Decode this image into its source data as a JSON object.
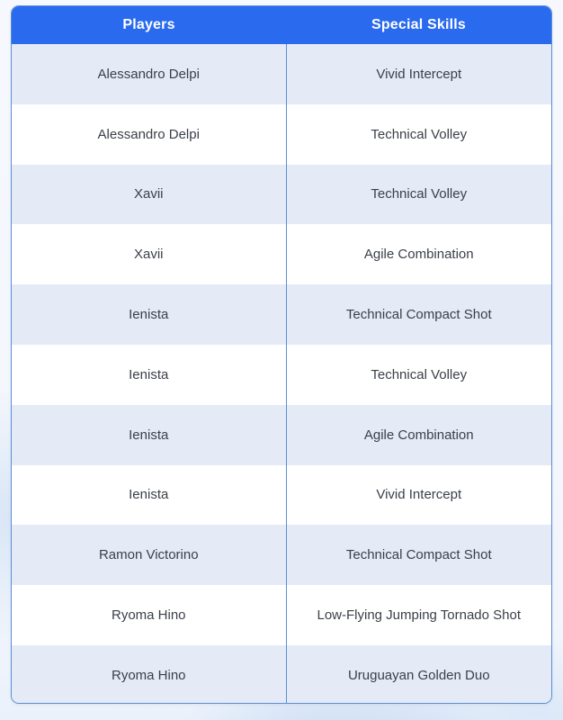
{
  "table": {
    "columns": [
      {
        "key": "player",
        "label": "Players"
      },
      {
        "key": "skill",
        "label": "Special Skills"
      }
    ],
    "rows": [
      {
        "player": "Alessandro Delpi",
        "skill": "Vivid Intercept"
      },
      {
        "player": "Alessandro Delpi",
        "skill": "Technical Volley"
      },
      {
        "player": "Xavii",
        "skill": "Technical Volley"
      },
      {
        "player": "Xavii",
        "skill": "Agile Combination"
      },
      {
        "player": "Ienista",
        "skill": "Technical Compact Shot"
      },
      {
        "player": "Ienista",
        "skill": "Technical Volley"
      },
      {
        "player": "Ienista",
        "skill": "Agile Combination"
      },
      {
        "player": "Ienista",
        "skill": "Vivid Intercept"
      },
      {
        "player": "Ramon Victorino",
        "skill": "Technical Compact Shot"
      },
      {
        "player": "Ryoma Hino",
        "skill": "Low-Flying Jumping Tornado Shot"
      },
      {
        "player": "Ryoma Hino",
        "skill": "Uruguayan Golden Duo"
      }
    ]
  },
  "colors": {
    "header_background": "#2a6aee",
    "header_text": "#ffffff",
    "row_alt_background": "#e5eaf7",
    "row_background": "#ffffff",
    "border": "#5b8fd4",
    "body_text": "#3a3f49",
    "page_background": "#f4f7fd"
  }
}
